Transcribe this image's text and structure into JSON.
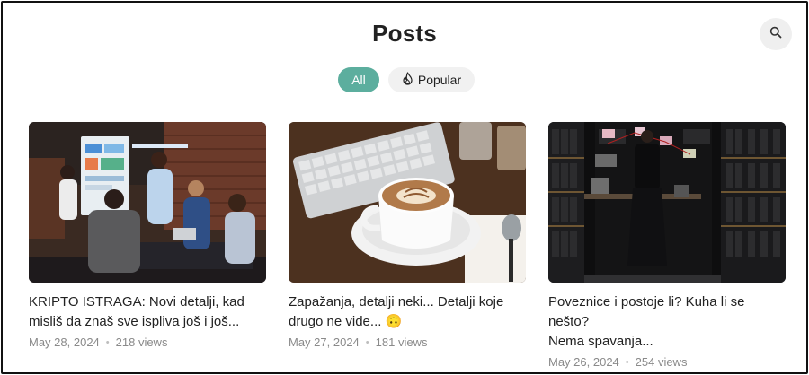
{
  "header": {
    "title": "Posts"
  },
  "search": {
    "icon": "search-icon"
  },
  "filters": [
    {
      "label": "All",
      "active": true
    },
    {
      "label": "Popular",
      "active": false,
      "icon": "flame-icon"
    }
  ],
  "colors": {
    "accent": "#5cae9e"
  },
  "posts": [
    {
      "title_line1": "KRIPTO ISTRAGA: Novi detalji, kad",
      "title_line2": "misliš da znaš sve ispliva još i još...",
      "date": "May 28, 2024",
      "views": "218 views",
      "image": "office-meeting-photo"
    },
    {
      "title_line1": "Zapažanja, detalji neki... Detalji koje",
      "title_line2": "drugo ne vide... 🙃",
      "date": "May 27, 2024",
      "views": "181 views",
      "image": "coffee-keyboard-photo"
    },
    {
      "title_line1": "Poveznice i postoje li? Kuha li se nešto?",
      "title_line2": "Nema spavanja...",
      "date": "May 26, 2024",
      "views": "254 views",
      "image": "archive-room-photo"
    }
  ]
}
